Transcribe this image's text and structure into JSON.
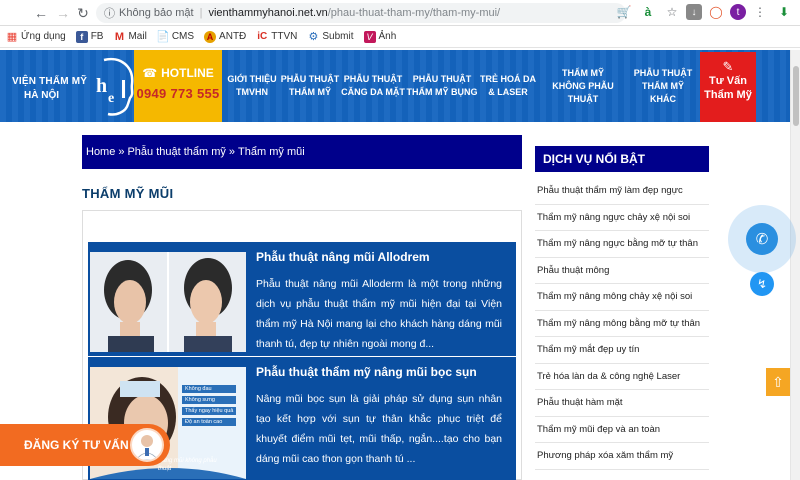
{
  "browser": {
    "security_label": "Không bảo mật",
    "url_host": "vienthammyhanoi.net.vn",
    "url_path": "/phau-thuat-tham-my/tham-my-mui/"
  },
  "bookmarks": [
    {
      "label": "Ứng dụng",
      "icon": "apps-icon"
    },
    {
      "label": "FB",
      "icon": "facebook-icon"
    },
    {
      "label": "Mail",
      "icon": "gmail-icon"
    },
    {
      "label": "CMS",
      "icon": "document-icon"
    },
    {
      "label": "ANTĐ",
      "icon": "antd-icon"
    },
    {
      "label": "TTVN",
      "icon": "ttvn-icon"
    },
    {
      "label": "Submit",
      "icon": "submit-icon"
    },
    {
      "label": "Ảnh",
      "icon": "photo-icon"
    }
  ],
  "header": {
    "logo_line1": "VIỆN THẨM MỸ",
    "logo_line2": "HÀ NỘI",
    "hotline_label": "HOTLINE",
    "hotline_number": "0949 773 555",
    "menu": [
      {
        "l1": "GIỚI THIỆU",
        "l2": "TMVHN"
      },
      {
        "l1": "PHẪU THUẬT",
        "l2": "THẨM MỸ"
      },
      {
        "l1": "PHẪU THUẬT",
        "l2": "CĂNG DA MẶT"
      },
      {
        "l1": "PHẪU THUẬT",
        "l2": "THẨM MỸ BỤNG"
      },
      {
        "l1": "TRẺ HOÁ DA",
        "l2": "& LASER"
      },
      {
        "l1": "THẨM MỸ",
        "l2": "KHÔNG PHẪU THUẬT"
      },
      {
        "l1": "PHẪU THUẬT",
        "l2": "THẨM MỸ KHÁC"
      }
    ],
    "consult_l1": "Tư Vấn",
    "consult_l2": "Thẩm Mỹ"
  },
  "breadcrumb": {
    "home": "Home",
    "sep": "»",
    "level1": "Phẫu thuật thẩm mỹ",
    "level2": "Thẩm mỹ mũi"
  },
  "page_title": "THẨM MỸ MŨI",
  "articles": [
    {
      "title": "Phẫu thuật nâng mũi Allodrem",
      "desc": "Phẫu thuật nâng mũi Alloderm là một trong những dịch vụ phẫu thuật thẩm mỹ mũi hiện đại tại Viện thẩm mỹ Hà Nội mang lại cho khách hàng dáng mũi thanh tú, đẹp tự nhiên ngoài mong đ..."
    },
    {
      "title": "Phẫu thuật thẩm mỹ nâng mũi bọc sụn",
      "desc": "Nâng mũi bọc sụn là giải pháp sử dụng sụn nhân tạo kết hợp với sụn tự thân khắc phục triệt để khuyết điểm mũi tẹt, mũi thấp, ngắn....tạo cho bạn dáng mũi cao thon gọn thanh tú ...",
      "thumb_bullets": [
        "Không đau",
        "Không sưng",
        "Thấy ngay hiệu quả",
        "Độ an toàn cao"
      ],
      "thumb_caption": "Nâng mũi không phẫu thuật"
    }
  ],
  "sidebar": {
    "title": "DỊCH VỤ NỔI BẬT",
    "items": [
      "Phẫu thuật thẩm mỹ làm đẹp ngực",
      "Thẩm mỹ nâng ngực chảy xệ nội soi",
      "Thẩm mỹ nâng ngực bằng mỡ tự thân",
      "Phẫu thuật mông",
      "Thẩm mỹ nâng mông chảy xệ nội soi",
      "Thẩm mỹ nâng mông bằng mỡ tự thân",
      "Thẩm mỹ mắt đẹp uy tín",
      "Trẻ hóa làn da & công nghệ Laser",
      "Phẫu thuật hàm mặt",
      "Thẩm mỹ mũi đẹp và an toàn",
      "Phương pháp xóa xăm thẩm mỹ"
    ]
  },
  "register_label": "ĐĂNG KÝ TƯ VẤN",
  "colors": {
    "header_blue": "#1565c0",
    "navy": "#00008b",
    "hotline_yellow": "#f5b800",
    "consult_red": "#e31d1d",
    "register_orange": "#f26b21"
  }
}
